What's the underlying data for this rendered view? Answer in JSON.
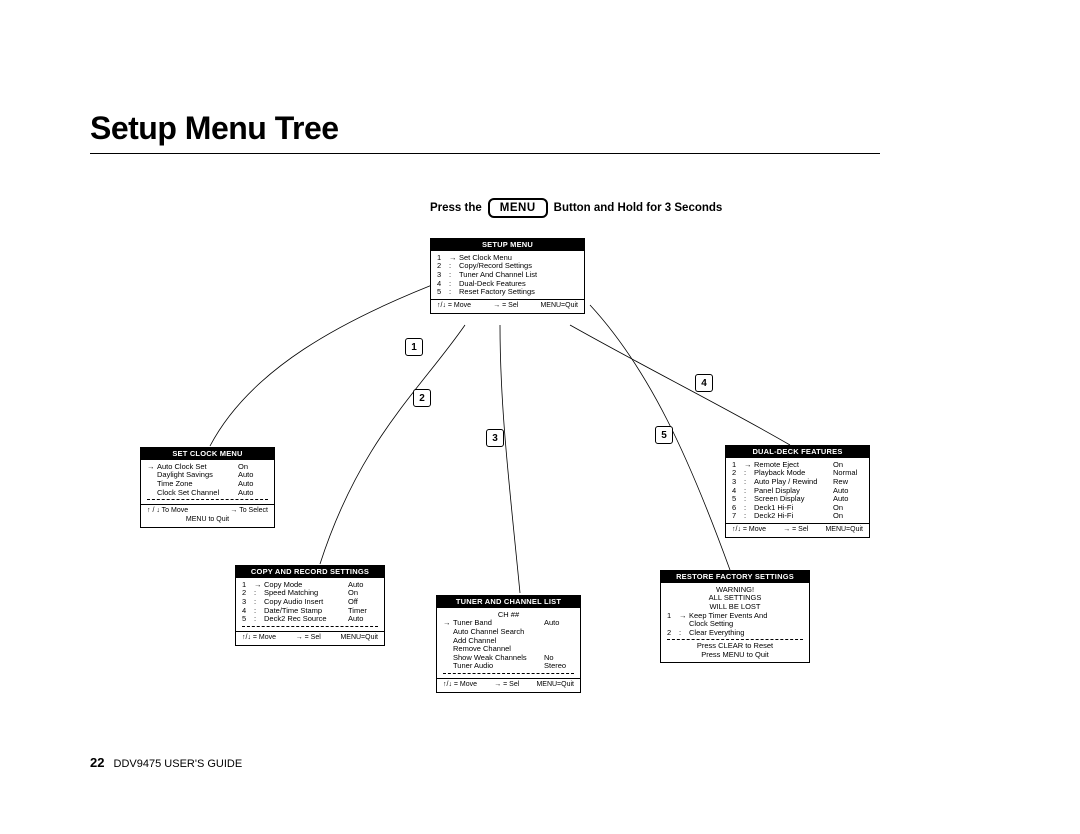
{
  "title": "Setup Menu Tree",
  "instruction": {
    "before": "Press the",
    "button": "MENU",
    "after": "Button and Hold for 3 Seconds"
  },
  "numBalls": [
    "1",
    "2",
    "3",
    "4",
    "5"
  ],
  "pageNumber": "22",
  "footerText": "DDV9475 USER'S GUIDE",
  "footerHints": {
    "move": "↑/↓  = Move",
    "sel": "→ = Sel",
    "menuQuit": "MENU=Quit",
    "toMove": "↑ / ↓    To Move",
    "toSelect": "→   To Select",
    "menuToQuit": "MENU to Quit",
    "clear": "Press CLEAR to Reset",
    "menuQuit2": "Press MENU to Quit"
  },
  "boxes": {
    "setup": {
      "title": "SETUP MENU",
      "items": [
        {
          "n": "1",
          "arr": "→",
          "lbl": "Set Clock Menu"
        },
        {
          "n": "2",
          "arr": ":",
          "lbl": "Copy/Record Settings"
        },
        {
          "n": "3",
          "arr": ":",
          "lbl": "Tuner And Channel List"
        },
        {
          "n": "4",
          "arr": ":",
          "lbl": "Dual-Deck Features"
        },
        {
          "n": "5",
          "arr": ":",
          "lbl": "Reset Factory Settings"
        }
      ]
    },
    "clock": {
      "title": "SET CLOCK MENU",
      "items": [
        {
          "arr": "→",
          "lbl": "Auto Clock Set",
          "val": "On"
        },
        {
          "arr": "",
          "lbl": "Daylight Savings",
          "val": "Auto"
        },
        {
          "arr": "",
          "lbl": "Time Zone",
          "val": "Auto"
        },
        {
          "arr": "",
          "lbl": "Clock Set Channel",
          "val": "Auto"
        }
      ]
    },
    "copy": {
      "title": "COPY AND RECORD SETTINGS",
      "items": [
        {
          "n": "1",
          "arr": "→",
          "lbl": "Copy Mode",
          "val": "Auto"
        },
        {
          "n": "2",
          "arr": ":",
          "lbl": "Speed Matching",
          "val": "On"
        },
        {
          "n": "3",
          "arr": ":",
          "lbl": "Copy Audio Insert",
          "val": "Off"
        },
        {
          "n": "4",
          "arr": ":",
          "lbl": "Date/Time Stamp",
          "val": "Timer"
        },
        {
          "n": "5",
          "arr": ":",
          "lbl": "Deck2 Rec Source",
          "val": "Auto"
        }
      ]
    },
    "tuner": {
      "title": "TUNER AND CHANNEL LIST",
      "sub": "CH ##",
      "items": [
        {
          "arr": "→",
          "lbl": "Tuner Band",
          "val": "Auto"
        },
        {
          "arr": "",
          "lbl": "Auto Channel Search",
          "val": ""
        },
        {
          "arr": "",
          "lbl": "Add Channel",
          "val": ""
        },
        {
          "arr": "",
          "lbl": "Remove Channel",
          "val": ""
        },
        {
          "arr": "",
          "lbl": "Show Weak Channels",
          "val": "No"
        },
        {
          "arr": "",
          "lbl": "Tuner Audio",
          "val": "Stereo"
        }
      ]
    },
    "dual": {
      "title": "DUAL-DECK FEATURES",
      "items": [
        {
          "n": "1",
          "arr": "→",
          "lbl": "Remote Eject",
          "val": "On"
        },
        {
          "n": "2",
          "arr": ":",
          "lbl": "Playback Mode",
          "val": "Normal"
        },
        {
          "n": "3",
          "arr": ":",
          "lbl": "Auto Play / Rewind",
          "val": "Rew"
        },
        {
          "n": "4",
          "arr": ":",
          "lbl": "Panel Display",
          "val": "Auto"
        },
        {
          "n": "5",
          "arr": ":",
          "lbl": "Screen Display",
          "val": "Auto"
        },
        {
          "n": "6",
          "arr": ":",
          "lbl": "Deck1 Hi-Fi",
          "val": "On"
        },
        {
          "n": "7",
          "arr": ":",
          "lbl": "Deck2 Hi-Fi",
          "val": "On"
        }
      ]
    },
    "restore": {
      "title": "RESTORE FACTORY SETTINGS",
      "warn": [
        "WARNING!",
        "ALL SETTINGS",
        "WILL BE LOST"
      ],
      "items": [
        {
          "n": "1",
          "arr": "→",
          "lbl": "Keep Timer Events And"
        },
        {
          "n": "",
          "arr": "",
          "lbl": "Clock Setting"
        },
        {
          "n": "2",
          "arr": ":",
          "lbl": "Clear Everything"
        }
      ]
    }
  }
}
